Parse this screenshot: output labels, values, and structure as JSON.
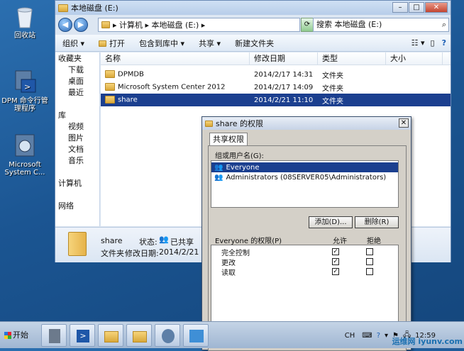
{
  "desktop": {
    "icons": [
      {
        "label": "回收站",
        "icon": "recycle-bin-icon"
      },
      {
        "label": "DPM 命令行管理程序",
        "icon": "dpm-shell-icon"
      },
      {
        "label": "Microsoft System C...",
        "icon": "dpm-console-icon"
      }
    ]
  },
  "explorer": {
    "title": "本地磁盘 (E:)",
    "address": "▸ 计算机 ▸ 本地磁盘 (E:) ▸",
    "search_placeholder": "搜索 本地磁盘 (E:)",
    "toolbar": {
      "organize": "组织 ▾",
      "open": "打开",
      "include": "包含到库中 ▾",
      "share": "共享 ▾",
      "new_folder": "新建文件夹"
    },
    "nav": [
      {
        "label": "收藏夹",
        "head": true
      },
      {
        "label": "下载",
        "head": false
      },
      {
        "label": "桌面",
        "head": false
      },
      {
        "label": "最近",
        "head": false
      },
      {
        "label": "",
        "head": false
      },
      {
        "label": "库",
        "head": true
      },
      {
        "label": "视频",
        "head": false
      },
      {
        "label": "图片",
        "head": false
      },
      {
        "label": "文档",
        "head": false
      },
      {
        "label": "音乐",
        "head": false
      },
      {
        "label": "",
        "head": false
      },
      {
        "label": "计算机",
        "head": true
      },
      {
        "label": "",
        "head": false
      },
      {
        "label": "网络",
        "head": true
      }
    ],
    "columns": [
      "名称",
      "修改日期",
      "类型",
      "大小"
    ],
    "rows": [
      {
        "name": "DPMDB",
        "date": "2014/2/17 14:31",
        "type": "文件夹",
        "selected": false
      },
      {
        "name": "Microsoft System Center 2012",
        "date": "2014/2/17 14:09",
        "type": "文件夹",
        "selected": false
      },
      {
        "name": "share",
        "date": "2014/2/21 11:10",
        "type": "文件夹",
        "selected": true
      }
    ],
    "details": {
      "name": "share",
      "state_label": "状态:",
      "state_value": "已共享",
      "kind": "文件夹",
      "modified_label": "修改日期:",
      "modified_value": "2014/2/21 11:"
    }
  },
  "dialog": {
    "title": "share 的权限",
    "close": "✕",
    "tab": "共享权限",
    "group_label": "组或用户名(G):",
    "users": [
      {
        "name": "Everyone",
        "selected": true
      },
      {
        "name": "Administrators (08SERVER05\\Administrators)",
        "selected": false
      }
    ],
    "add_button": "添加(D)...",
    "remove_button": "删除(R)",
    "perm_label": "Everyone 的权限(P)",
    "allow_label": "允许",
    "deny_label": "拒绝",
    "permissions": [
      {
        "name": "完全控制",
        "allow": "✓",
        "deny": ""
      },
      {
        "name": "更改",
        "allow": "✓",
        "deny": ""
      },
      {
        "name": "读取",
        "allow": "✓",
        "deny": ""
      }
    ]
  },
  "taskbar": {
    "start": "开始",
    "lang": "CH",
    "time": "12:59"
  },
  "watermark": "运维网 iyunv.com"
}
